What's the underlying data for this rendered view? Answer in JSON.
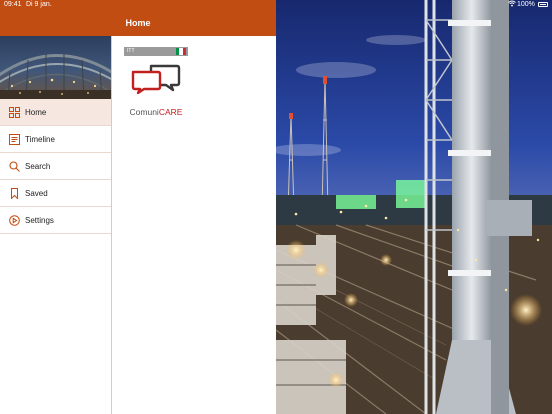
{
  "status_bar": {
    "time": "09:41",
    "date": "Di 9 jan.",
    "battery": "100%"
  },
  "nav": {
    "title": "Home"
  },
  "sidebar": {
    "items": [
      {
        "label": "Home",
        "icon": "grid-icon",
        "active": true
      },
      {
        "label": "Timeline",
        "icon": "timeline-icon",
        "active": false
      },
      {
        "label": "Search",
        "icon": "search-icon",
        "active": false
      },
      {
        "label": "Saved",
        "icon": "bookmark-icon",
        "active": false
      },
      {
        "label": "Settings",
        "icon": "settings-icon",
        "active": false
      }
    ]
  },
  "content": {
    "tiles": [
      {
        "badge": "ITT",
        "title_main": "Comuni",
        "title_accent": "CARE",
        "flag": [
          "#009246",
          "#ffffff",
          "#ce2b37"
        ]
      }
    ]
  },
  "colors": {
    "accent": "#c24d12",
    "active_bg": "#f6e8e0",
    "logo_red": "#c21f1f",
    "logo_dark": "#3a3a3a"
  }
}
